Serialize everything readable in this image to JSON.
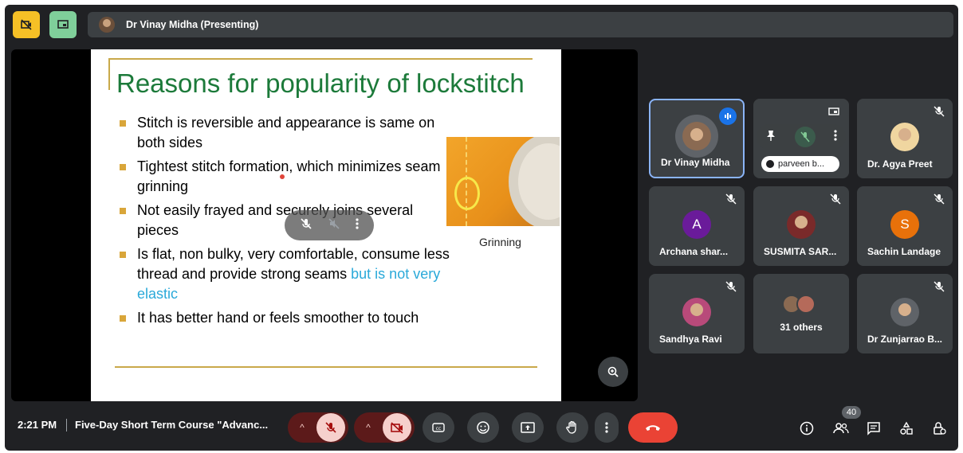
{
  "top_bar": {
    "presenter_label": "Dr Vinay Midha (Presenting)"
  },
  "slide": {
    "title": "Reasons for popularity of lockstitch",
    "bullets": [
      "Stitch is reversible and appearance is same on both sides",
      "Tightest stitch formation, which minimizes seam grinning",
      "Not easily frayed and securely joins several pieces",
      "Is flat, non bulky, very comfortable, consume less thread and provide strong seams ",
      "It has better hand or feels smoother to touch"
    ],
    "bullet4_highlight": "but is not very elastic",
    "figure_caption": "Grinning",
    "title_color": "#1c7a3a",
    "highlight_color": "#2aa9d9"
  },
  "participants": [
    {
      "name": "Dr Vinay Midha",
      "state": "speaking"
    },
    {
      "name_chip": "parveen b..."
    },
    {
      "name": "Dr. Agya Preet"
    },
    {
      "name": "Archana shar...",
      "initial": "A",
      "color": "#6a1b9a"
    },
    {
      "name": "SUSMITA SAR..."
    },
    {
      "name": "Sachin Landage",
      "initial": "S",
      "color": "#e8710a"
    },
    {
      "name": "Sandhya Ravi"
    },
    {
      "others": "31 others"
    },
    {
      "name": "Dr Zunjarrao B..."
    }
  ],
  "bottom_bar": {
    "time": "2:21 PM",
    "meeting_title": "Five-Day Short Term Course \"Advanc...",
    "participant_count": "40"
  },
  "colors": {
    "end_call": "#ea4335",
    "background": "#202124",
    "tile": "#3c4043"
  }
}
